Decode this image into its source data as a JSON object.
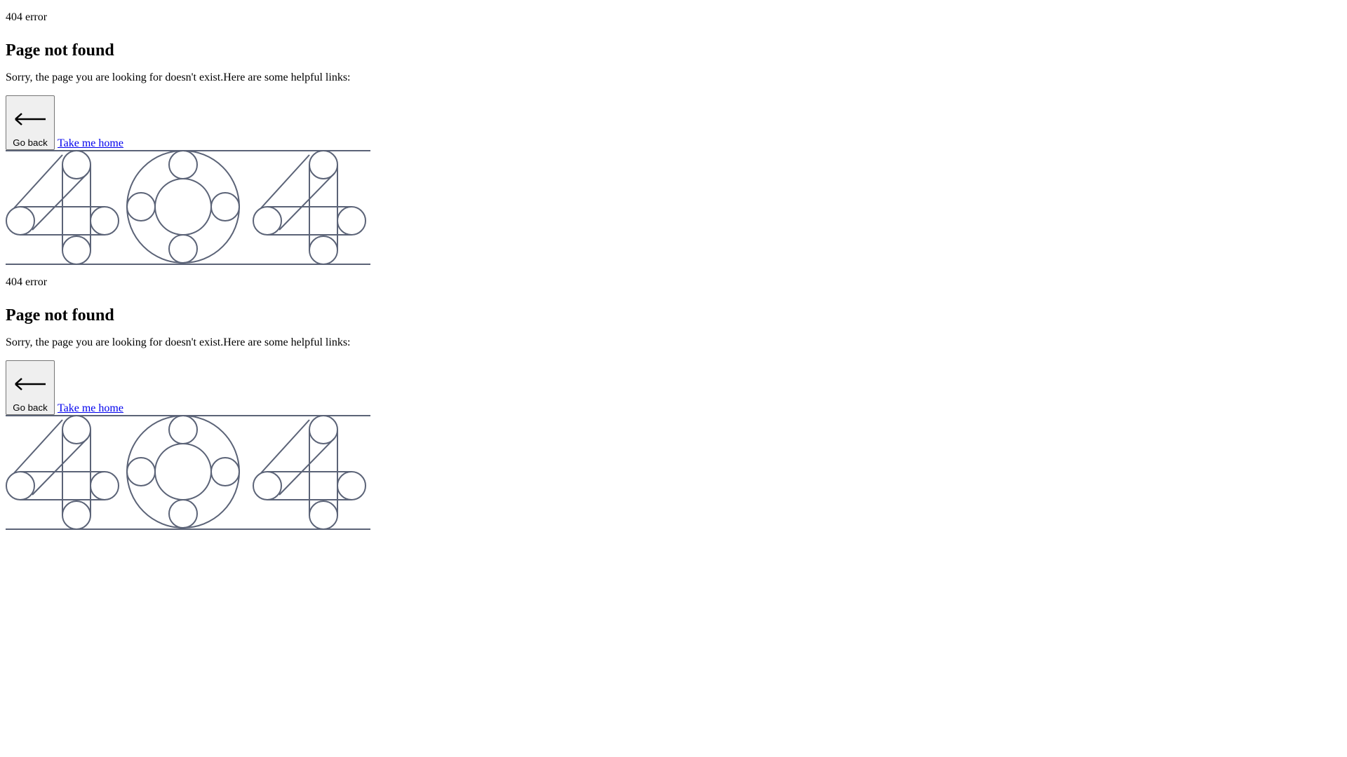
{
  "sections": [
    {
      "eyebrow": "404 error",
      "title": "Page not found",
      "description": "Sorry, the page you are looking for doesn't exist.Here are some helpful links:",
      "back_label": "Go back",
      "home_label": "Take me home",
      "illustration_icon": "404-outline-illustration"
    },
    {
      "eyebrow": "404 error",
      "title": "Page not found",
      "description": "Sorry, the page you are looking for doesn't exist.Here are some helpful links:",
      "back_label": "Go back",
      "home_label": "Take me home",
      "illustration_icon": "404-outline-illustration"
    }
  ],
  "colors": {
    "illustration_stroke": "#5b6377",
    "link": "#0000ee"
  }
}
